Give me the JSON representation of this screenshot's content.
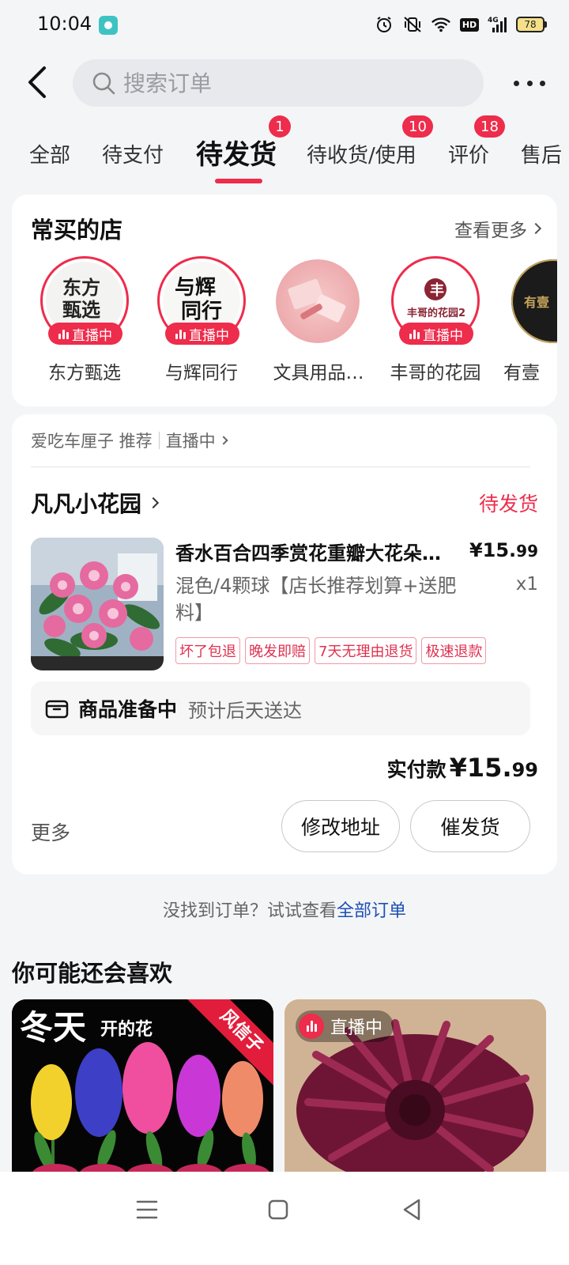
{
  "status_bar": {
    "time": "10:04",
    "battery": "78"
  },
  "search": {
    "placeholder": "搜索订单"
  },
  "tabs": [
    {
      "label": "全部"
    },
    {
      "label": "待支付"
    },
    {
      "label": "待发货",
      "badge": "1"
    },
    {
      "label": "待收货/使用",
      "badge": "10"
    },
    {
      "label": "评价",
      "badge": "18"
    },
    {
      "label": "售后"
    }
  ],
  "stores": {
    "title": "常买的店",
    "more": "查看更多",
    "live_label": "直播中",
    "items": [
      {
        "name": "东方甄选",
        "live": true
      },
      {
        "name": "与辉同行",
        "live": true
      },
      {
        "name": "文具用品…",
        "live": false
      },
      {
        "name": "丰哥的花园",
        "live": true
      },
      {
        "name": "有壹",
        "live": false
      }
    ]
  },
  "order": {
    "recommender": "爱吃车厘子 推荐",
    "live_link": "直播中",
    "shop_name": "凡凡小花园",
    "status": "待发货",
    "product_title": "香水百合四季赏花重瓣大花朵…",
    "price_main": "¥15.",
    "price_cents": "99",
    "spec": "混色/4颗球【店长推荐划算+送肥料】",
    "qty": "x1",
    "tags": [
      "坏了包退",
      "晚发即赔",
      "7天无理由退货",
      "极速退款"
    ],
    "delivery_title": "商品准备中",
    "delivery_eta": "预计后天送达",
    "paid_label": "实付款",
    "paid_main": "¥15.",
    "paid_cents": "99",
    "more_label": "更多",
    "btn_address": "修改地址",
    "btn_urge": "催发货"
  },
  "not_found": {
    "text": "没找到订单？试试查看",
    "link": "全部订单"
  },
  "recommend": {
    "title": "你可能还会喜欢",
    "card1": {
      "big": "冬天",
      "small": "开的花",
      "ribbon": "风信子"
    },
    "card2": {
      "live": "直播中"
    }
  },
  "colors": {
    "accent": "#ee2c4b",
    "link": "#1e4fb5"
  }
}
